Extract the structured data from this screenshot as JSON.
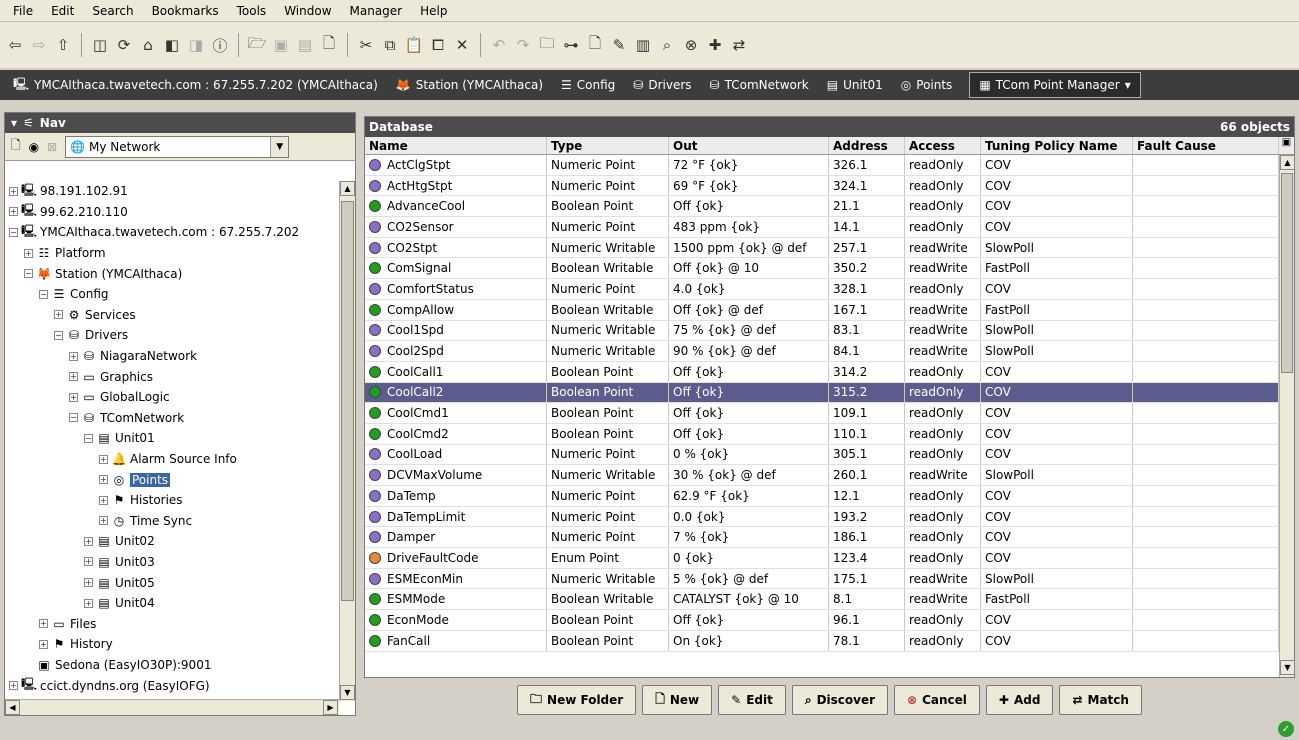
{
  "menu": [
    "File",
    "Edit",
    "Search",
    "Bookmarks",
    "Tools",
    "Window",
    "Manager",
    "Help"
  ],
  "locbar": [
    {
      "label": "YMCAIthaca.twavetech.com : 67.255.7.202 (YMCAIthaca)",
      "icon": "monitor-icon",
      "ic": "🖳"
    },
    {
      "label": "Station (YMCAIthaca)",
      "icon": "fox-icon",
      "ic": "🦊"
    },
    {
      "label": "Config",
      "icon": "config-icon",
      "ic": "☰"
    },
    {
      "label": "Drivers",
      "icon": "drivers-icon",
      "ic": "⛁"
    },
    {
      "label": "TComNetwork",
      "icon": "network-icon",
      "ic": "⛁"
    },
    {
      "label": "Unit01",
      "icon": "device-icon",
      "ic": "▤"
    },
    {
      "label": "Points",
      "icon": "points-icon",
      "ic": "◎"
    }
  ],
  "view_selector": {
    "label": "TCom Point Manager"
  },
  "nav": {
    "title": "Nav",
    "selector": "My Network",
    "tree": [
      {
        "label": "98.191.102.91",
        "depth": 0,
        "toggle": "+",
        "ic": "🖳",
        "icon": "host-icon"
      },
      {
        "label": "99.62.210.110",
        "depth": 0,
        "toggle": "+",
        "ic": "🖳",
        "icon": "host-icon"
      },
      {
        "label": "YMCAIthaca.twavetech.com : 67.255.7.202",
        "depth": 0,
        "toggle": "−",
        "ic": "🖳",
        "icon": "host-icon"
      },
      {
        "label": "Platform",
        "depth": 1,
        "toggle": "+",
        "ic": "☷",
        "icon": "platform-icon"
      },
      {
        "label": "Station (YMCAIthaca)",
        "depth": 1,
        "toggle": "−",
        "ic": "🦊",
        "icon": "fox-icon"
      },
      {
        "label": "Config",
        "depth": 2,
        "toggle": "−",
        "ic": "☰",
        "icon": "config-icon"
      },
      {
        "label": "Services",
        "depth": 3,
        "toggle": "+",
        "ic": "⚙",
        "icon": "services-icon"
      },
      {
        "label": "Drivers",
        "depth": 3,
        "toggle": "−",
        "ic": "⛁",
        "icon": "drivers-icon"
      },
      {
        "label": "NiagaraNetwork",
        "depth": 4,
        "toggle": "+",
        "ic": "⛁",
        "icon": "network-icon"
      },
      {
        "label": "Graphics",
        "depth": 4,
        "toggle": "+",
        "ic": "▭",
        "icon": "folder-icon"
      },
      {
        "label": "GlobalLogic",
        "depth": 4,
        "toggle": "+",
        "ic": "▭",
        "icon": "folder-icon"
      },
      {
        "label": "TComNetwork",
        "depth": 4,
        "toggle": "−",
        "ic": "⛁",
        "icon": "network-icon"
      },
      {
        "label": "Unit01",
        "depth": 5,
        "toggle": "−",
        "ic": "▤",
        "icon": "device-icon"
      },
      {
        "label": "Alarm Source Info",
        "depth": 6,
        "toggle": "+",
        "ic": "🔔",
        "icon": "alarm-icon"
      },
      {
        "label": "Points",
        "depth": 6,
        "toggle": "+",
        "ic": "◎",
        "icon": "points-icon",
        "selected": true
      },
      {
        "label": "Histories",
        "depth": 6,
        "toggle": "+",
        "ic": "⚑",
        "icon": "histories-icon"
      },
      {
        "label": "Time Sync",
        "depth": 6,
        "toggle": "+",
        "ic": "◷",
        "icon": "clock-icon"
      },
      {
        "label": "Unit02",
        "depth": 5,
        "toggle": "+",
        "ic": "▤",
        "icon": "device-icon"
      },
      {
        "label": "Unit03",
        "depth": 5,
        "toggle": "+",
        "ic": "▤",
        "icon": "device-icon"
      },
      {
        "label": "Unit05",
        "depth": 5,
        "toggle": "+",
        "ic": "▤",
        "icon": "device-icon"
      },
      {
        "label": "Unit04",
        "depth": 5,
        "toggle": "+",
        "ic": "▤",
        "icon": "device-icon"
      },
      {
        "label": "Files",
        "depth": 2,
        "toggle": "+",
        "ic": "▭",
        "icon": "files-icon"
      },
      {
        "label": "History",
        "depth": 2,
        "toggle": "+",
        "ic": "⚑",
        "icon": "history-icon"
      },
      {
        "label": "Sedona (EasyIO30P):9001",
        "depth": 1,
        "toggle": "",
        "ic": "▣",
        "icon": "sedona-icon"
      },
      {
        "label": "ccict.dyndns.org (EasyIOFG)",
        "depth": 0,
        "toggle": "+",
        "ic": "🖳",
        "icon": "host-icon"
      }
    ]
  },
  "database": {
    "title": "Database",
    "count": "66 objects",
    "columns": [
      "Name",
      "Type",
      "Out",
      "Address",
      "Access",
      "Tuning Policy Name",
      "Fault Cause"
    ],
    "rows": [
      [
        "ActClgStpt",
        "Numeric Point",
        "72 °F {ok}",
        "326.1",
        "readOnly",
        "COV",
        "",
        "purple"
      ],
      [
        "ActHtgStpt",
        "Numeric Point",
        "69 °F {ok}",
        "324.1",
        "readOnly",
        "COV",
        "",
        "purple"
      ],
      [
        "AdvanceCool",
        "Boolean Point",
        "Off {ok}",
        "21.1",
        "readOnly",
        "COV",
        "",
        "green"
      ],
      [
        "CO2Sensor",
        "Numeric Point",
        "483 ppm {ok}",
        "14.1",
        "readOnly",
        "COV",
        "",
        "purple"
      ],
      [
        "CO2Stpt",
        "Numeric Writable",
        "1500 ppm {ok} @ def",
        "257.1",
        "readWrite",
        "SlowPoll",
        "",
        "purple"
      ],
      [
        "ComSignal",
        "Boolean Writable",
        "Off {ok} @ 10",
        "350.2",
        "readWrite",
        "FastPoll",
        "",
        "green"
      ],
      [
        "ComfortStatus",
        "Numeric Point",
        "4.0 {ok}",
        "328.1",
        "readOnly",
        "COV",
        "",
        "purple"
      ],
      [
        "CompAllow",
        "Boolean Writable",
        "Off {ok} @ def",
        "167.1",
        "readWrite",
        "FastPoll",
        "",
        "green"
      ],
      [
        "Cool1Spd",
        "Numeric Writable",
        "75 % {ok} @ def",
        "83.1",
        "readWrite",
        "SlowPoll",
        "",
        "purple"
      ],
      [
        "Cool2Spd",
        "Numeric Writable",
        "90 % {ok} @ def",
        "84.1",
        "readWrite",
        "SlowPoll",
        "",
        "purple"
      ],
      [
        "CoolCall1",
        "Boolean Point",
        "Off {ok}",
        "314.2",
        "readOnly",
        "COV",
        "",
        "green"
      ],
      [
        "CoolCall2",
        "Boolean Point",
        "Off {ok}",
        "315.2",
        "readOnly",
        "COV",
        "",
        "green"
      ],
      [
        "CoolCmd1",
        "Boolean Point",
        "Off {ok}",
        "109.1",
        "readOnly",
        "COV",
        "",
        "green"
      ],
      [
        "CoolCmd2",
        "Boolean Point",
        "Off {ok}",
        "110.1",
        "readOnly",
        "COV",
        "",
        "green"
      ],
      [
        "CoolLoad",
        "Numeric Point",
        "0 % {ok}",
        "305.1",
        "readOnly",
        "COV",
        "",
        "purple"
      ],
      [
        "DCVMaxVolume",
        "Numeric Writable",
        "30 % {ok} @ def",
        "260.1",
        "readWrite",
        "SlowPoll",
        "",
        "purple"
      ],
      [
        "DaTemp",
        "Numeric Point",
        "62.9 °F {ok}",
        "12.1",
        "readOnly",
        "COV",
        "",
        "purple"
      ],
      [
        "DaTempLimit",
        "Numeric Point",
        "0.0 {ok}",
        "193.2",
        "readOnly",
        "COV",
        "",
        "purple"
      ],
      [
        "Damper",
        "Numeric Point",
        "7 % {ok}",
        "186.1",
        "readOnly",
        "COV",
        "",
        "purple"
      ],
      [
        "DriveFaultCode",
        "Enum Point",
        "0 {ok}",
        "123.4",
        "readOnly",
        "COV",
        "",
        "orange"
      ],
      [
        "ESMEconMin",
        "Numeric Writable",
        "5 % {ok} @ def",
        "175.1",
        "readWrite",
        "SlowPoll",
        "",
        "purple"
      ],
      [
        "ESMMode",
        "Boolean Writable",
        "CATALYST {ok} @ 10",
        "8.1",
        "readWrite",
        "FastPoll",
        "",
        "green"
      ],
      [
        "EconMode",
        "Boolean Point",
        "Off {ok}",
        "96.1",
        "readOnly",
        "COV",
        "",
        "green"
      ],
      [
        "FanCall",
        "Boolean Point",
        "On {ok}",
        "78.1",
        "readOnly",
        "COV",
        "",
        "green"
      ]
    ],
    "selected_row": 11
  },
  "buttons": [
    {
      "label": "New Folder",
      "icon": "new-folder-icon",
      "ic": "🗀"
    },
    {
      "label": "New",
      "icon": "new-icon",
      "ic": "🗋"
    },
    {
      "label": "Edit",
      "icon": "edit-icon",
      "ic": "✎"
    },
    {
      "label": "Discover",
      "icon": "binoculars-icon",
      "ic": "⌕"
    },
    {
      "label": "Cancel",
      "icon": "cancel-icon",
      "ic": "⊗"
    },
    {
      "label": "Add",
      "icon": "add-icon",
      "ic": "✚"
    },
    {
      "label": "Match",
      "icon": "match-icon",
      "ic": "⇄"
    }
  ],
  "colors": {
    "purple": "#8a6fc8",
    "green": "#1f9e1f",
    "orange": "#e88a3a",
    "selection": "#5c5c8e"
  }
}
